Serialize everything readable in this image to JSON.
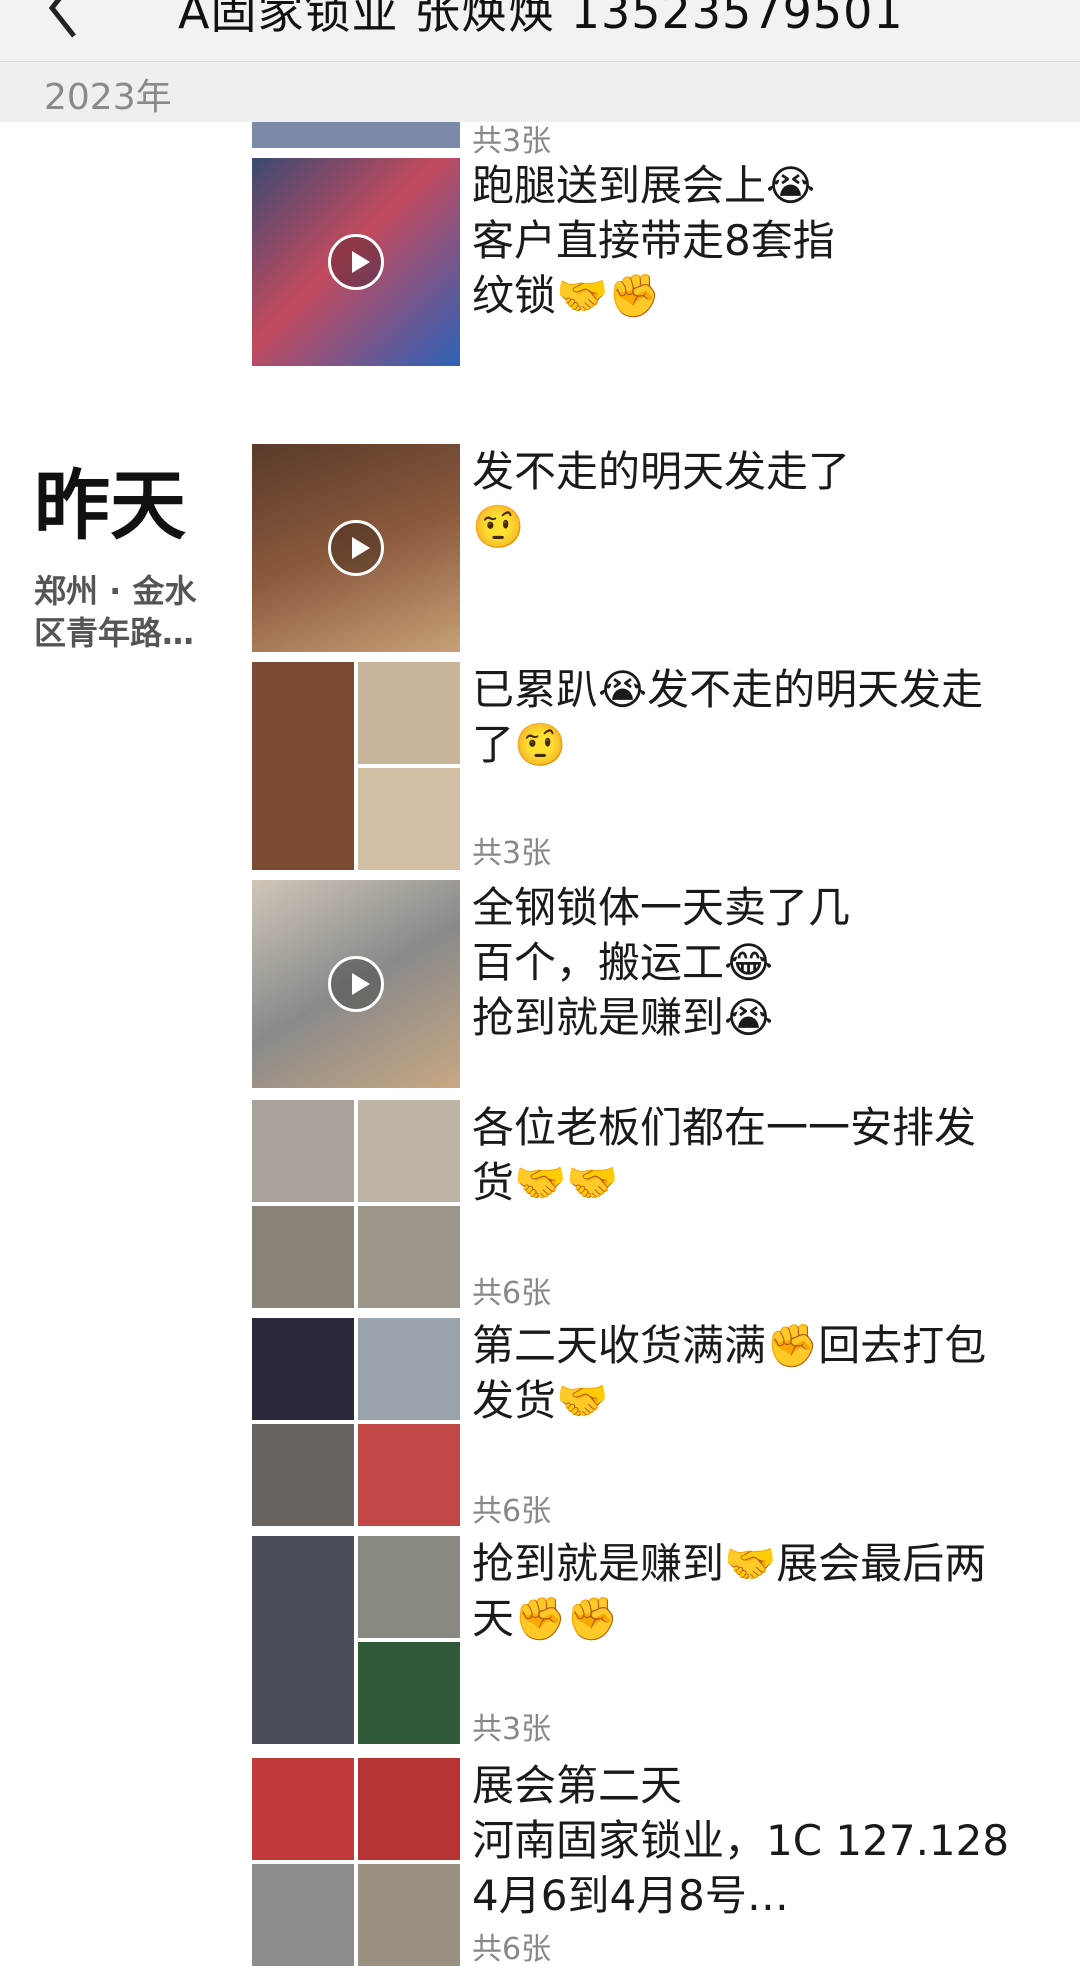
{
  "header": {
    "title": "A固家锁业 张焕焕 13523579501",
    "year": "2023年"
  },
  "timeline": {
    "day_label": "昨天",
    "location": "郑州 · 金水区青年路…"
  },
  "posts": [
    {
      "text": "",
      "count": "共3张",
      "type": "partial"
    },
    {
      "text": "跑腿送到展会上😭\n客户直接带走8套指\n纹锁🤝✊",
      "count": "",
      "type": "video"
    },
    {
      "text": "发不走的明天发走了\n🤨",
      "count": "",
      "type": "video"
    },
    {
      "text": "已累趴😭发不走的明天发走\n了🤨",
      "count": "共3张",
      "type": "grid3"
    },
    {
      "text": "全钢锁体一天卖了几\n百个，搬运工😂\n抢到就是赚到😭",
      "count": "",
      "type": "video"
    },
    {
      "text": "各位老板们都在一一安排发\n货🤝🤝",
      "count": "共6张",
      "type": "grid4"
    },
    {
      "text": "第二天收货满满✊回去打包\n发货🤝",
      "count": "共6张",
      "type": "grid4"
    },
    {
      "text": "抢到就是赚到🤝展会最后两\n天✊✊",
      "count": "共3张",
      "type": "grid3"
    },
    {
      "text": "展会第二天\n河南固家锁业，1C 127.128\n4月6到4月8号…",
      "count": "共6张",
      "type": "grid4"
    }
  ],
  "icons": {
    "back": "chevron-left-icon",
    "play": "play-icon"
  },
  "colors": {
    "header_bg": "#f2f2f2",
    "year_text": "#8a8a8a",
    "count_text": "#888888"
  }
}
